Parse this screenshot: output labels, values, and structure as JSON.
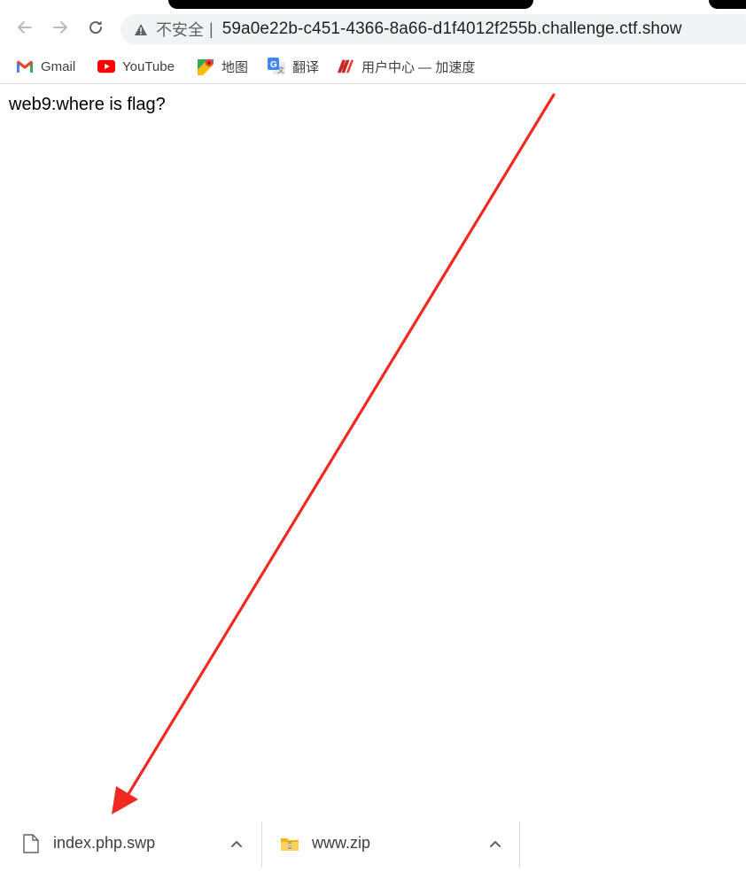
{
  "browser": {
    "security_label": "不安全",
    "separator": "|",
    "url": "59a0e22b-c451-4366-8a66-d1f4012f255b.challenge.ctf.show"
  },
  "bookmarks": [
    {
      "label": "Gmail",
      "icon": "gmail-icon"
    },
    {
      "label": "YouTube",
      "icon": "youtube-icon"
    },
    {
      "label": "地图",
      "icon": "maps-icon"
    },
    {
      "label": "翻译",
      "icon": "translate-icon"
    },
    {
      "label": "用户中心 — 加速度",
      "icon": "accelerator-icon"
    }
  ],
  "page": {
    "heading": "web9:where is flag?"
  },
  "annotation": {
    "arrow_color": "#f02a20"
  },
  "downloads": [
    {
      "filename": "index.php.swp",
      "icon": "file-icon"
    },
    {
      "filename": "www.zip",
      "icon": "zip-folder-icon"
    }
  ],
  "colors": {
    "omnibox_bg": "#f1f3f4",
    "youtube_red": "#ff0000",
    "gmail_red": "#ea4335"
  }
}
